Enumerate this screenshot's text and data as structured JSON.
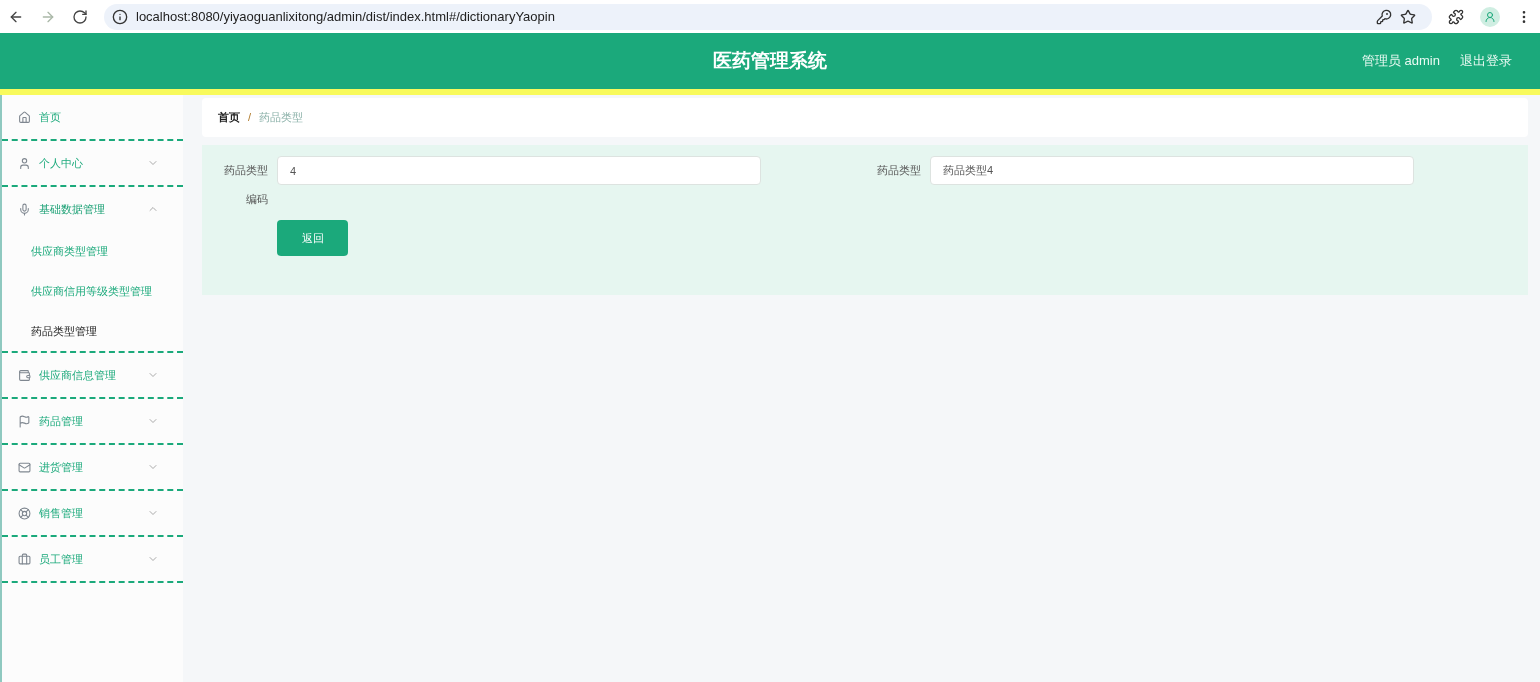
{
  "browser": {
    "url": "localhost:8080/yiyaoguanlixitong/admin/dist/index.html#/dictionaryYaopin",
    "forward_disabled": true
  },
  "header": {
    "title": "医药管理系统",
    "user": "管理员 admin",
    "logout": "退出登录"
  },
  "sidebar": {
    "items": [
      {
        "label": "首页"
      },
      {
        "label": "个人中心",
        "expanded": false
      },
      {
        "label": "基础数据管理",
        "expanded": true,
        "children": [
          {
            "label": "供应商类型管理",
            "selected": false
          },
          {
            "label": "供应商信用等级类型管理",
            "selected": false
          },
          {
            "label": "药品类型管理",
            "selected": true
          }
        ]
      },
      {
        "label": "供应商信息管理",
        "expanded": false
      },
      {
        "label": "药品管理",
        "expanded": false
      },
      {
        "label": "进货管理",
        "expanded": false
      },
      {
        "label": "销售管理",
        "expanded": false
      },
      {
        "label": "员工管理",
        "expanded": false
      }
    ]
  },
  "breadcrumb": [
    "首页",
    "药品类型"
  ],
  "breadcrumb_separator": "/",
  "form": {
    "fields": [
      {
        "label": "药品类型编码",
        "value": "4"
      },
      {
        "label": "药品类型",
        "value": "药品类型4"
      }
    ],
    "back_button": "返回"
  }
}
